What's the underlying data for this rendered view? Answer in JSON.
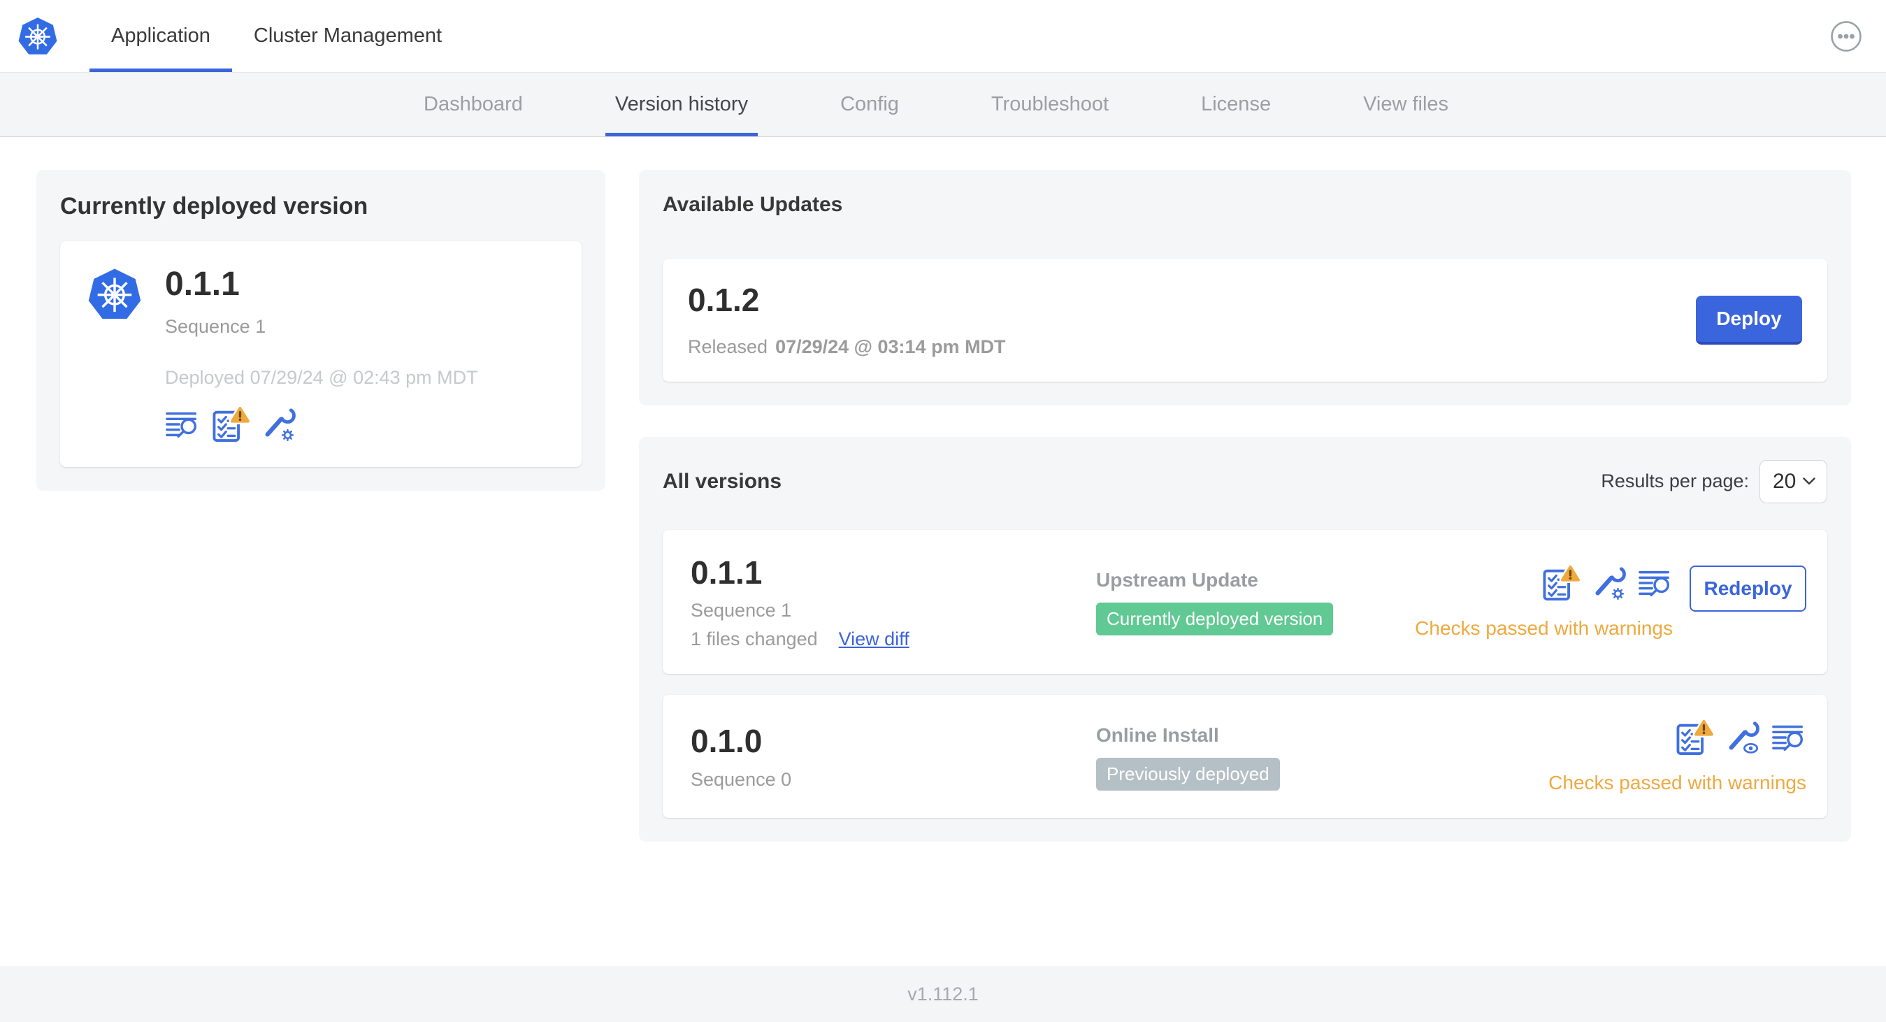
{
  "topbar": {
    "tabs": [
      {
        "label": "Application",
        "active": true
      },
      {
        "label": "Cluster Management",
        "active": false
      }
    ],
    "more_menu_icon": "ellipsis-circle"
  },
  "subnav": {
    "items": [
      {
        "label": "Dashboard",
        "active": false
      },
      {
        "label": "Version history",
        "active": true
      },
      {
        "label": "Config",
        "active": false
      },
      {
        "label": "Troubleshoot",
        "active": false
      },
      {
        "label": "License",
        "active": false
      },
      {
        "label": "View files",
        "active": false
      }
    ]
  },
  "current_version": {
    "title": "Currently deployed version",
    "version": "0.1.1",
    "sequence": "Sequence 1",
    "deployed": "Deployed 07/29/24 @ 02:43 pm MDT",
    "icons": [
      "release-notes",
      "preflight-checks-warning",
      "config-gear"
    ]
  },
  "available_updates": {
    "title": "Available Updates",
    "update": {
      "version": "0.1.2",
      "released_label": "Released",
      "released_date": "07/29/24 @ 03:14 pm MDT",
      "deploy_button": "Deploy"
    }
  },
  "all_versions": {
    "title": "All versions",
    "results_per_page_label": "Results per page:",
    "results_per_page_value": "20",
    "rows": [
      {
        "version": "0.1.1",
        "sequence": "Sequence 1",
        "files_changed": "1 files changed",
        "view_diff_link": "View diff",
        "source": "Upstream Update",
        "badge": "Currently deployed version",
        "badge_style": "green",
        "icons": [
          "preflight-checks-warning",
          "config-gear",
          "release-notes"
        ],
        "action_button": "Redeploy",
        "status": "Checks passed with warnings"
      },
      {
        "version": "0.1.0",
        "sequence": "Sequence 0",
        "source": "Online Install",
        "badge": "Previously deployed",
        "badge_style": "gray",
        "icons": [
          "preflight-checks-warning",
          "config-view",
          "release-notes"
        ],
        "status": "Checks passed with warnings"
      }
    ]
  },
  "footer": {
    "version_label": "v1.112.1"
  },
  "colors": {
    "primary_blue": "#3b65dd",
    "kubernetes_blue": "#326ce5",
    "icon_blue": "#4070df",
    "badge_green": "#61c993",
    "badge_gray": "#b4bfc6",
    "warning_orange": "#efa93f",
    "link_blue": "#3b63dd"
  }
}
